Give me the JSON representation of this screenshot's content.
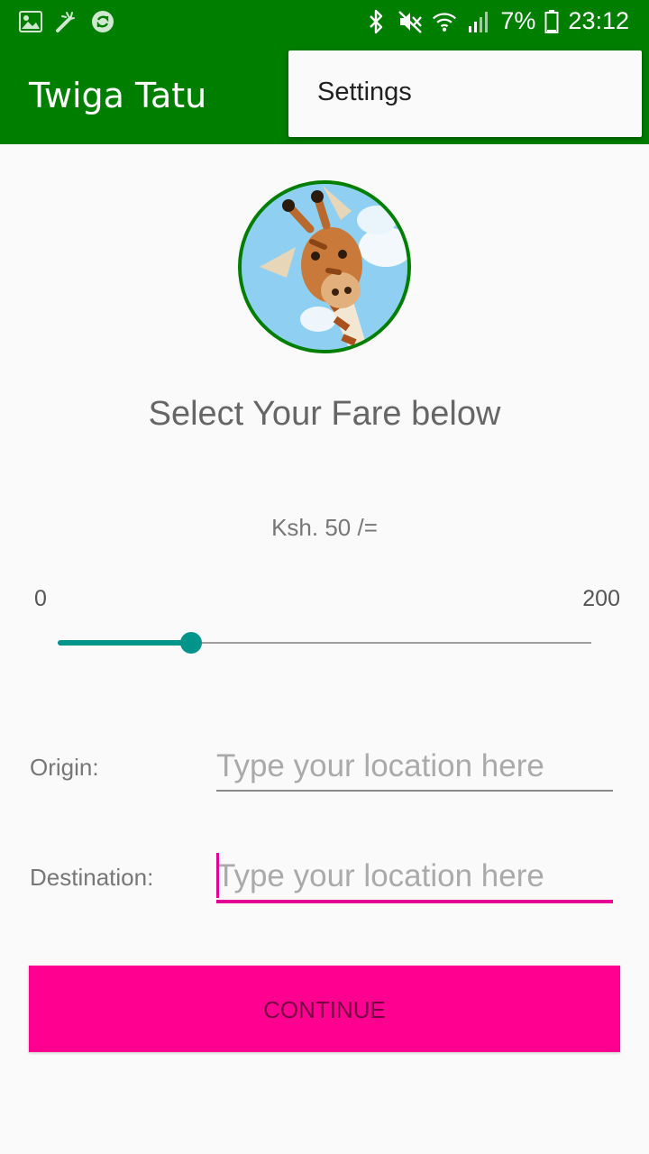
{
  "status_bar": {
    "battery": "7%",
    "time": "23:12",
    "left_icons": [
      "image-icon",
      "magic-wand-icon",
      "sync-icon"
    ],
    "right_icons": [
      "bluetooth-icon",
      "mute-icon",
      "wifi-icon",
      "signal-icon",
      "battery-icon"
    ]
  },
  "app_bar": {
    "title": "Twiga Tatu"
  },
  "overflow_menu": {
    "items": [
      {
        "label": "Settings"
      }
    ]
  },
  "main": {
    "heading": "Select Your Fare below",
    "fare": {
      "display": "Ksh. 50 /=",
      "min_label": "0",
      "max_label": "200",
      "min": 0,
      "max": 200,
      "value": 50
    },
    "origin": {
      "label": "Origin:",
      "placeholder": "Type your location here"
    },
    "destination": {
      "label": "Destination:",
      "placeholder": "Type your location here"
    },
    "continue_label": "CONTINUE"
  },
  "colors": {
    "primary": "#007e00",
    "accent": "#ff0090",
    "slider": "#00948b",
    "focus_line": "#e20095"
  }
}
